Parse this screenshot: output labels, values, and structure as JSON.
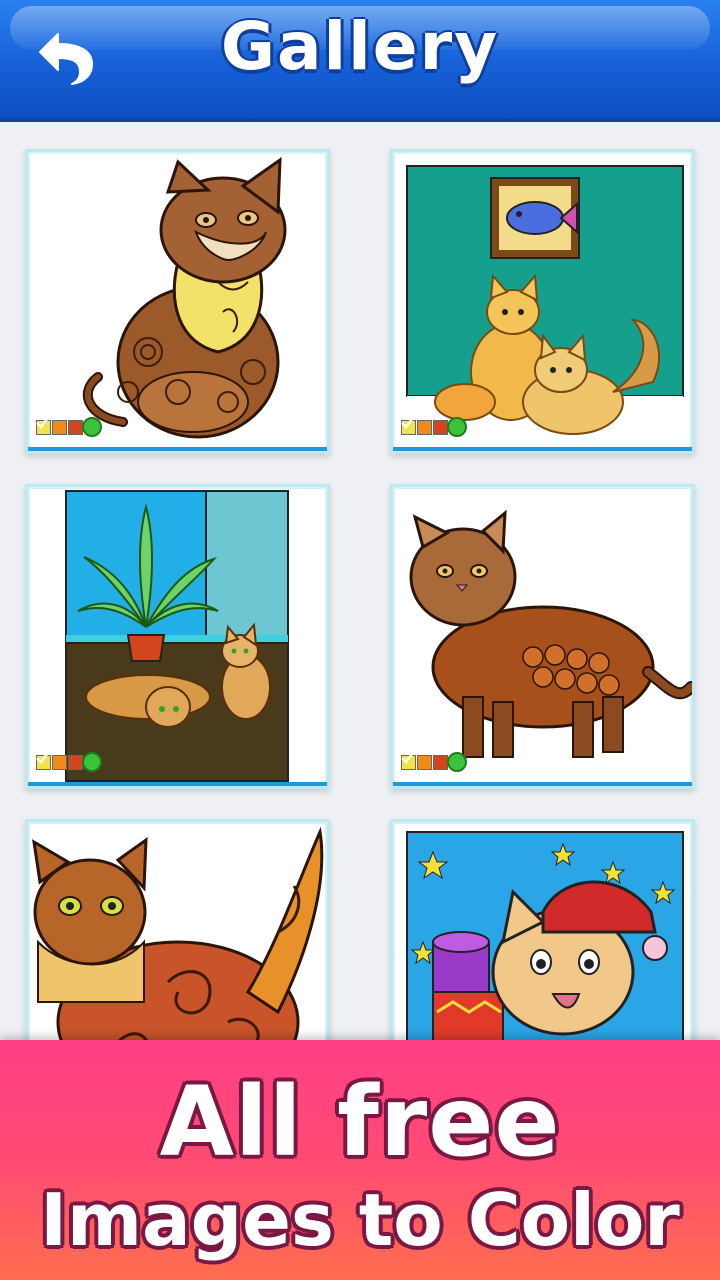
{
  "header": {
    "title": "Gallery",
    "back_icon": "undo-arrow-icon",
    "color": "#1660d8"
  },
  "gallery": {
    "items": [
      {
        "name": "mandala-cat-sitting",
        "completed": true,
        "palette": [
          "#f3e34a",
          "#f08a1a",
          "#d2451e"
        ]
      },
      {
        "name": "two-cats-fish-painting",
        "completed": true,
        "palette": [
          "#f3e34a",
          "#f08a1a",
          "#d2451e"
        ]
      },
      {
        "name": "cats-with-plant",
        "completed": true,
        "palette": [
          "#f3e34a",
          "#f08a1a",
          "#d2451e"
        ]
      },
      {
        "name": "feathered-cat-standing",
        "completed": true,
        "palette": [
          "#f3e34a",
          "#f08a1a",
          "#d2451e"
        ]
      },
      {
        "name": "striped-cat-swirl-tail",
        "completed": false
      },
      {
        "name": "christmas-cat-gifts",
        "completed": false
      }
    ]
  },
  "banner": {
    "line1": "All free",
    "line2": "Images to Color",
    "colors": [
      "#ff3f86",
      "#ff6e4e"
    ]
  }
}
